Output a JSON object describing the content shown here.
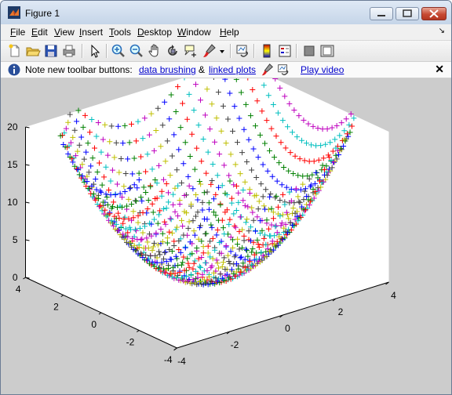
{
  "window": {
    "title": "Figure 1"
  },
  "menu": [
    {
      "key": "F",
      "rest": "ile"
    },
    {
      "key": "E",
      "rest": "dit"
    },
    {
      "key": "V",
      "rest": "iew"
    },
    {
      "key": "I",
      "rest": "nsert"
    },
    {
      "key": "T",
      "rest": "ools"
    },
    {
      "key": "D",
      "rest": "esktop"
    },
    {
      "key": "W",
      "rest": "indow"
    },
    {
      "key": "H",
      "rest": "elp"
    }
  ],
  "toolbar_icons": [
    "new-figure-icon",
    "open-file-icon",
    "save-icon",
    "print-icon",
    "edit-plot-arrow-icon",
    "zoom-in-icon",
    "zoom-out-icon",
    "pan-hand-icon",
    "rotate-3d-icon",
    "data-cursor-icon",
    "brush-icon",
    "brush-dropdown-icon",
    "link-plot-icon",
    "colorbar-icon",
    "legend-icon",
    "hide-plot-tools-icon",
    "show-plot-tools-icon"
  ],
  "notebar": {
    "text": "Note new toolbar buttons:",
    "link_brushing": "data brushing",
    "amp": "&",
    "link_linked": "linked plots",
    "link_video": "Play video",
    "close": "✕"
  },
  "chart_data": {
    "type": "scatter",
    "marker": "+",
    "function": "z = x^2 + y^2",
    "x_range": [
      -4,
      4
    ],
    "y_range": [
      -4,
      4
    ],
    "zlim": [
      0,
      20
    ],
    "x_ticks": [
      "-4",
      "-2",
      "0",
      "2",
      "4"
    ],
    "y_ticks": [
      "-4",
      "-2",
      "0",
      "2",
      "4"
    ],
    "z_ticks": [
      "0",
      "5",
      "10",
      "15",
      "20"
    ],
    "series_colors": [
      "#0000ff",
      "#008000",
      "#ff0000",
      "#00bfbf",
      "#bf00bf",
      "#bfbf00",
      "#404040"
    ],
    "grid": false
  }
}
